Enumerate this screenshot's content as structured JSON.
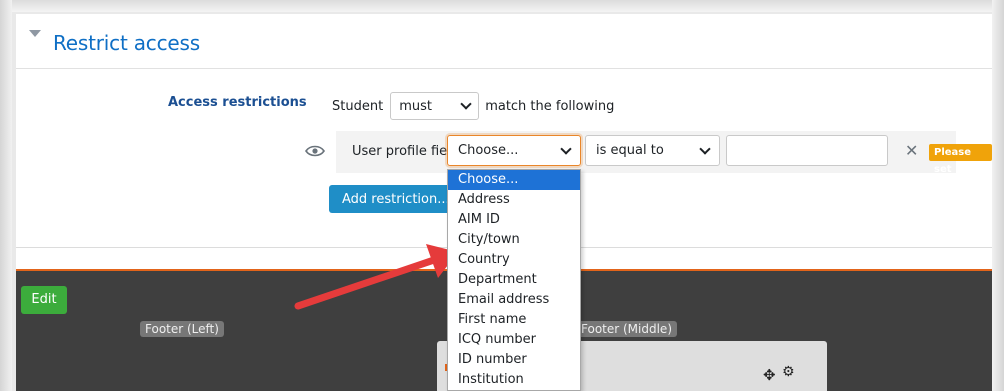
{
  "section": {
    "title": "Restrict access"
  },
  "restrictions": {
    "label": "Access restrictions",
    "student_label": "Student",
    "must_value": "must",
    "match_label": "match the following"
  },
  "condition": {
    "type_label": "User profile field",
    "field_value": "Choose...",
    "operator_value": "is equal to",
    "value_input": "",
    "badge": "Please set"
  },
  "add_button": "Add restriction...",
  "dropdown": {
    "options": [
      "Choose...",
      "Address",
      "AIM ID",
      "City/town",
      "Country",
      "Department",
      "Email address",
      "First name",
      "ICQ number",
      "ID number",
      "Institution"
    ],
    "selected_index": 0
  },
  "footer": {
    "edit_label": "Edit",
    "left_label": "Footer (Left)",
    "middle_label": "Footer (Middle)"
  },
  "colors": {
    "accent": "#0f6fc5",
    "focus_border": "#e9862a",
    "badge": "#f0a30a",
    "button": "#1f8ec7",
    "edit_button": "#3cac3c",
    "footer_bg": "#3f3f3f",
    "annotation_arrow": "#e53b3b",
    "dropdown_highlight": "#1e72d6"
  },
  "icons": [
    "chevron-down-icon",
    "eye-icon",
    "close-icon",
    "move-icon",
    "gear-icon"
  ]
}
